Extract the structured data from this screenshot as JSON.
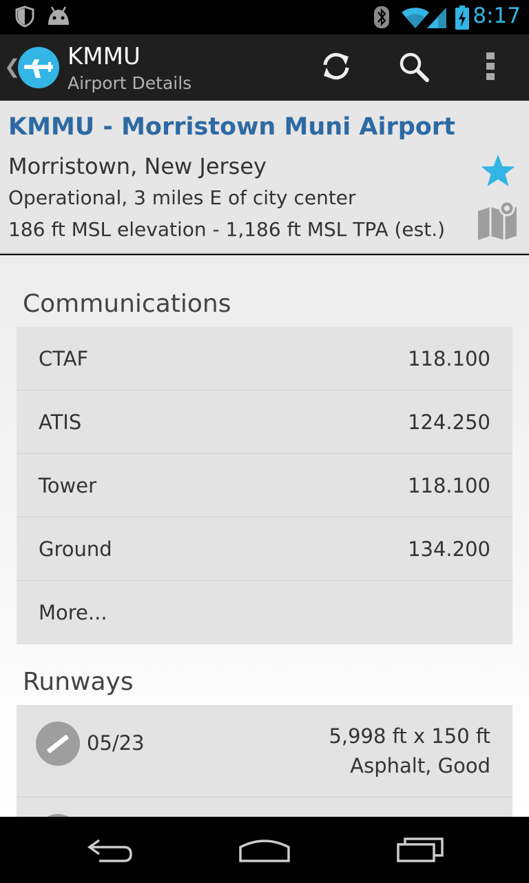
{
  "status_bar": {
    "time": "8:17",
    "icons": [
      "shield-icon",
      "android-icon",
      "bluetooth-icon",
      "wifi-icon",
      "signal-icon",
      "battery-charging-icon"
    ]
  },
  "action_bar": {
    "title": "KMMU",
    "subtitle": "Airport Details",
    "actions": [
      "refresh-icon",
      "search-icon",
      "overflow-menu-icon"
    ]
  },
  "airport": {
    "name": "KMMU - Morristown Muni Airport",
    "location": "Morristown, New Jersey",
    "status": "Operational, 3 miles E of city center",
    "elevation": "186 ft MSL elevation - 1,186 ft MSL TPA  (est.)"
  },
  "communications": {
    "title": "Communications",
    "rows": [
      {
        "label": "CTAF",
        "value": "118.100"
      },
      {
        "label": "ATIS",
        "value": "124.250"
      },
      {
        "label": "Tower",
        "value": "118.100"
      },
      {
        "label": "Ground",
        "value": "134.200"
      }
    ],
    "more": "More..."
  },
  "runways": {
    "title": "Runways",
    "rows": [
      {
        "id": "05/23",
        "dimensions": "5,998 ft x 150 ft",
        "surface": "Asphalt, Good"
      }
    ]
  },
  "colors": {
    "accent": "#33b5e5",
    "link_title": "#2d6aa3"
  }
}
